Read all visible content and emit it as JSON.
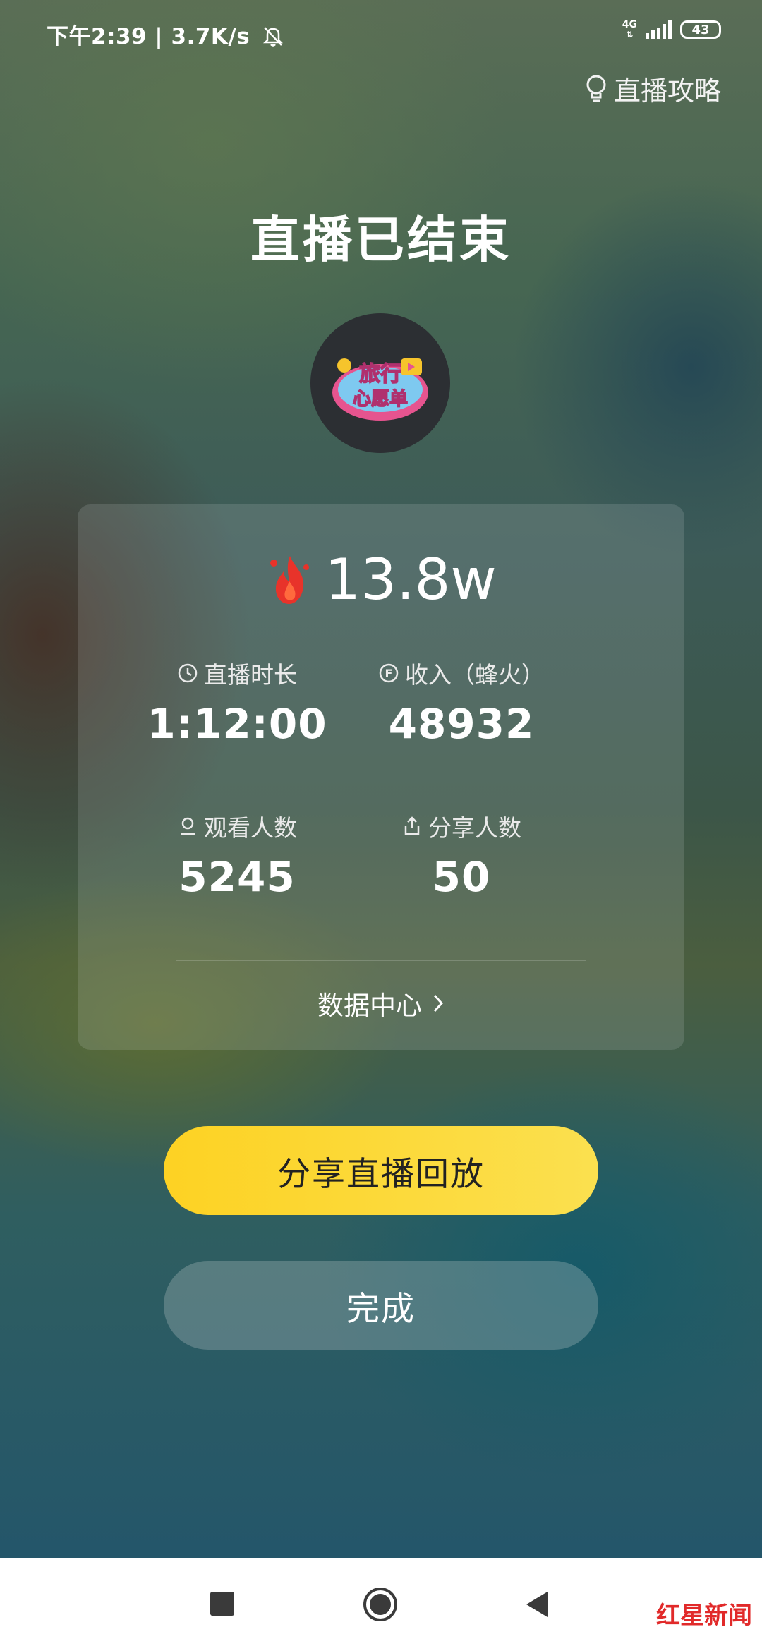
{
  "status_bar": {
    "time_speed": "下午2:39 | 3.7K/s",
    "network": "4G",
    "battery": "43"
  },
  "header": {
    "guide_link": "直播攻略"
  },
  "title": "直播已结束",
  "avatar": {
    "line1": "旅行",
    "line2": "心愿单"
  },
  "stats": {
    "heat_value": "13.8w",
    "duration_label": "直播时长",
    "duration_value": "1:12:00",
    "income_label": "收入（蜂火）",
    "income_value": "48932",
    "viewers_label": "观看人数",
    "viewers_value": "5245",
    "shares_label": "分享人数",
    "shares_value": "50",
    "data_center": "数据中心"
  },
  "buttons": {
    "share_replay": "分享直播回放",
    "done": "完成"
  },
  "watermark": "红星新闻",
  "colors": {
    "primary_button": "#FDD223",
    "fire": "#E8332A"
  }
}
